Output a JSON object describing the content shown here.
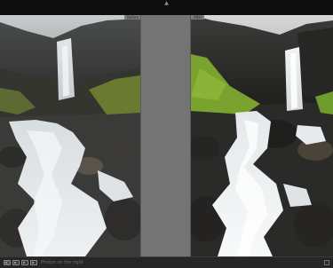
{
  "compare_view": {
    "left_pane": {
      "tab_label": "Before"
    },
    "right_pane": {
      "tab_label": "After"
    }
  },
  "toolbar": {
    "caption": "Photos on the right",
    "tools": [
      {
        "icon": "grid-view-icon"
      },
      {
        "icon": "loupe-view-icon"
      },
      {
        "icon": "compare-view-icon"
      },
      {
        "icon": "survey-view-icon"
      }
    ]
  },
  "colors": {
    "chrome_dark": "#0d0d0d",
    "canvas_gray": "#6a6a6a",
    "gutter_gray": "#747474",
    "toolbar_bg": "#262626"
  }
}
